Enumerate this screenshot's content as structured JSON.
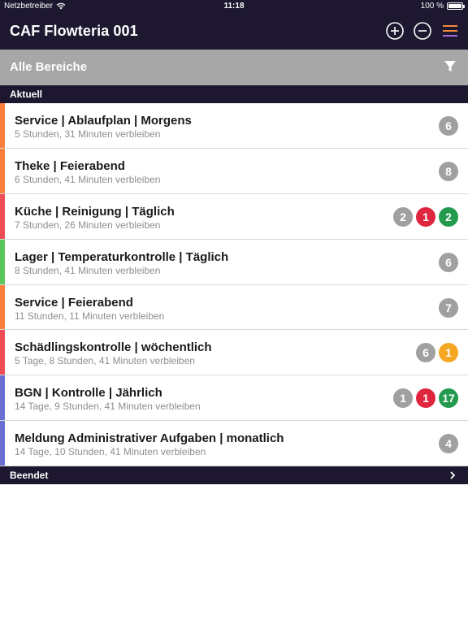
{
  "status_bar": {
    "carrier": "Netzbetreiber",
    "time": "11:18",
    "battery": "100 %",
    "battery_level": 1.0,
    "icons": {
      "wifi": "wifi-icon",
      "battery": "battery-icon"
    }
  },
  "nav": {
    "title": "CAF Flowteria 001",
    "buttons": [
      "plus-circle-icon",
      "minus-circle-icon",
      "menu-icon"
    ]
  },
  "filter": {
    "title": "Alle Bereiche",
    "icon": "filter-icon"
  },
  "sections": {
    "current": "Aktuell",
    "done": "Beendet"
  },
  "colors": {
    "header_bg": "#1d1830",
    "filter_bg": "#a7a7a7",
    "badge_gray": "#a0a0a0",
    "badge_red": "#e0263e",
    "badge_green": "#239a4e",
    "badge_orange": "#f5a623",
    "menu_icon_accent": "#f08a3c"
  },
  "tasks": [
    {
      "title": "Service | Ablaufplan | Morgens",
      "subtitle": "5 Stunden, 31 Minuten verbleiben",
      "stripe": "#fd7e3c",
      "badges": [
        {
          "value": "6",
          "color": "#a0a0a0"
        }
      ]
    },
    {
      "title": "Theke | Feierabend",
      "subtitle": "6 Stunden, 41 Minuten verbleiben",
      "stripe": "#fd7e3c",
      "badges": [
        {
          "value": "8",
          "color": "#a0a0a0"
        }
      ]
    },
    {
      "title": "Küche | Reinigung | Täglich",
      "subtitle": "7 Stunden, 26 Minuten verbleiben",
      "stripe": "#ee4d56",
      "badges": [
        {
          "value": "2",
          "color": "#a0a0a0"
        },
        {
          "value": "1",
          "color": "#e0263e"
        },
        {
          "value": "2",
          "color": "#239a4e"
        }
      ]
    },
    {
      "title": "Lager | Temperaturkontrolle | Täglich",
      "subtitle": "8 Stunden, 41 Minuten verbleiben",
      "stripe": "#5cc65b",
      "badges": [
        {
          "value": "6",
          "color": "#a0a0a0"
        }
      ]
    },
    {
      "title": "Service | Feierabend",
      "subtitle": "11 Stunden, 11 Minuten verbleiben",
      "stripe": "#fd7e3c",
      "badges": [
        {
          "value": "7",
          "color": "#a0a0a0"
        }
      ]
    },
    {
      "title": "Schädlingskontrolle | wöchentlich",
      "subtitle": "5 Tage, 8 Stunden, 41 Minuten verbleiben",
      "stripe": "#ee4d56",
      "badges": [
        {
          "value": "6",
          "color": "#a0a0a0"
        },
        {
          "value": "1",
          "color": "#f5a623"
        }
      ]
    },
    {
      "title": "BGN | Kontrolle | Jährlich",
      "subtitle": "14 Tage, 9 Stunden, 41 Minuten verbleiben",
      "stripe": "#6a6fd6",
      "badges": [
        {
          "value": "1",
          "color": "#a0a0a0"
        },
        {
          "value": "1",
          "color": "#e0263e"
        },
        {
          "value": "17",
          "color": "#239a4e"
        }
      ]
    },
    {
      "title": "Meldung Administrativer Aufgaben | monatlich",
      "subtitle": "14 Tage, 10 Stunden, 41 Minuten verbleiben",
      "stripe": "#6a6fd6",
      "badges": [
        {
          "value": "4",
          "color": "#a0a0a0"
        }
      ]
    }
  ]
}
